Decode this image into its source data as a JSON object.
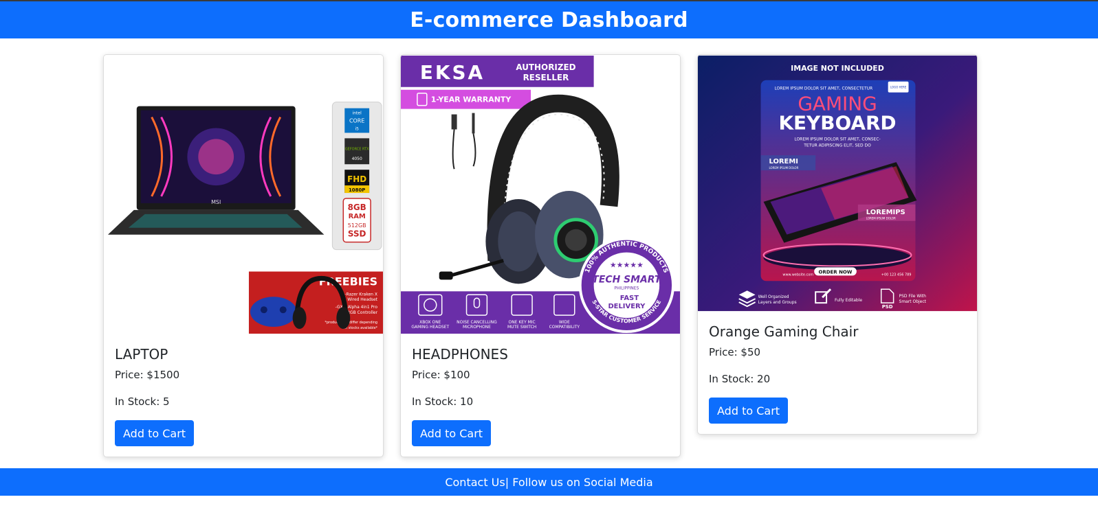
{
  "header": {
    "title": "E-commerce Dashboard"
  },
  "products": [
    {
      "name": "LAPTOP",
      "price": "Price: $1500",
      "stock": "In Stock: 5",
      "button": "Add to Cart",
      "image_text": {
        "brand": "MSI",
        "badge_cpu": "CORE",
        "badge_cpu_brand": "intel",
        "badge_cpu_gen": "i5",
        "badge_gpu": "GEFORCE RTX",
        "badge_gpu_model": "4050",
        "badge_fhd": "FHD",
        "badge_fhd_res": "1080P",
        "badge_ram": "8GB",
        "badge_ram_label": "RAM",
        "badge_ssd": "512GB",
        "badge_ssd_label": "SSD",
        "freebies_title": "FREEBIES",
        "freebies_line1": "-Razer Kraken X",
        "freebies_line2": "Wired Headset",
        "freebies_line3": "-GXM Alpha 4in1 Pro",
        "freebies_line4": "RGB Controller",
        "freebies_note1": "*product may differ depending",
        "freebies_note2": "on stocks available*"
      }
    },
    {
      "name": "HEADPHONES",
      "price": "Price: $100",
      "stock": "In Stock: 10",
      "button": "Add to Cart",
      "image_text": {
        "logo": "EKSA",
        "reseller_line1": "AUTHORIZED",
        "reseller_line2": "RESELLER",
        "warranty": "1-YEAR WARRANTY",
        "feature1_line1": "XBOX ONE",
        "feature1_line2": "GAMING HEADSET",
        "feature2_line1": "NOISE CANCELLING",
        "feature2_line2": "MICROPHONE",
        "feature3_line1": "ONE KEY MIC",
        "feature3_line2": "MUTE SWITCH",
        "feature4_line1": "WIDE",
        "feature4_line2": "COMPATIBILITY",
        "seal_ring_top": "100% AUTHENTIC PRODUCTS",
        "seal_ring_bottom": "5-STAR CUSTOMER SERVICE",
        "seal_stars": "★★★★★",
        "seal_brand": "TECH SMART",
        "seal_country": "PHILIPPINES",
        "seal_line1": "FAST",
        "seal_line2": "DELIVERY"
      }
    },
    {
      "name": "Orange Gaming Chair",
      "price": "Price: $50",
      "stock": "In Stock: 20",
      "button": "Add to Cart",
      "image_text": {
        "top": "IMAGE NOT INCLUDED",
        "lorem_top": "LOREM IPSUM DOLOR SIT AMET, CONSECTETUR",
        "logo": "LOGO HERE",
        "title1": "GAMING",
        "title2": "KEYBOARD",
        "subtitle1": "LOREM IPSUM DOLOR SIT AMET, CONSEC-",
        "subtitle2": "TETUR ADIPISCING ELIT, SED DO",
        "tag1": "LOREMI",
        "tag1_sub": "LOREM IPSUM DOLOR",
        "tag2": "LOREMIPS",
        "tag2_sub": "LOREM IPSUM DOLOR",
        "website": "www.website.com",
        "order": "ORDER NOW",
        "phone": "+00 123 456 789",
        "foot1_line1": "Well Organized",
        "foot1_line2": "Layers and Groups",
        "foot2": "Fully Editable",
        "foot3_badge": "PSD",
        "foot3_line1": "PSD File With",
        "foot3_line2": "Smart Object"
      }
    }
  ],
  "footer": {
    "text": "Contact Us| Follow us on Social Media"
  },
  "colors": {
    "primary": "#0d6efd",
    "freebies_red": "#c41f1f",
    "eksa_purple": "#6a2ea8",
    "warranty_magenta": "#d44de0"
  }
}
